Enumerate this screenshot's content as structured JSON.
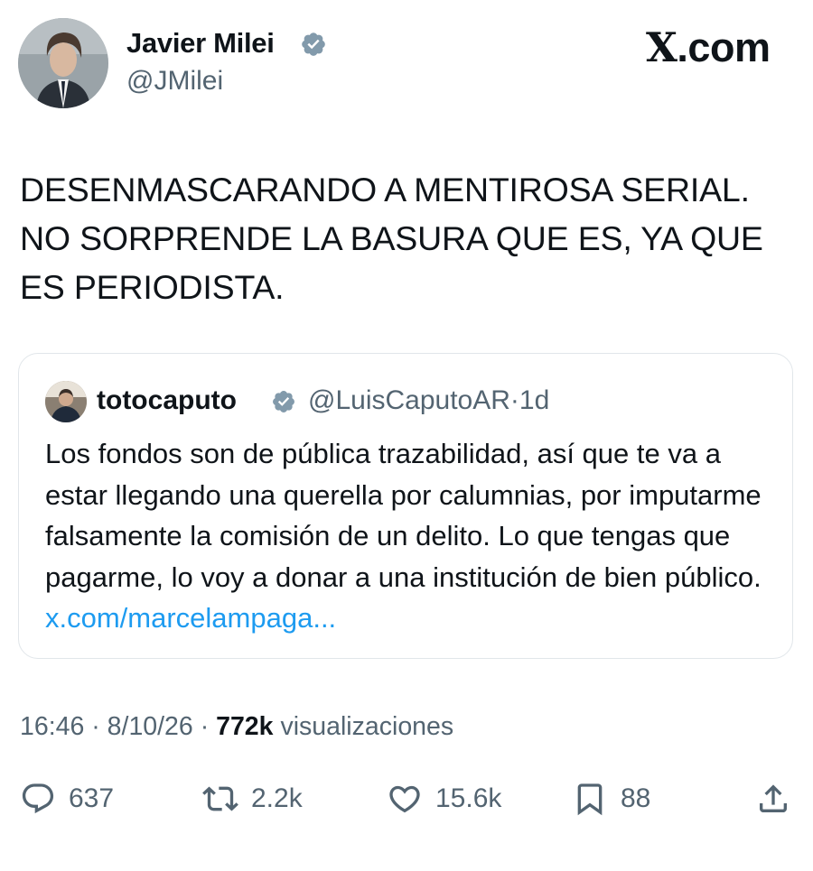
{
  "header": {
    "author_name": "Javier Milei",
    "author_handle": "@JMilei",
    "brand": "X.com",
    "brand_mark": "X",
    "brand_suffix": ".com"
  },
  "tweet": {
    "text": "DESENMASCARANDO A MENTIROSA SERIAL. NO SORPRENDE LA BASURA QUE ES, YA QUE ES PERIODISTA."
  },
  "quote": {
    "author_name": "totocaputo",
    "author_handle": "@LuisCaputoAR",
    "separator": "·",
    "age": "1d",
    "text": "Los fondos son de pública trazabilidad, así que te va a estar llegando una querella por calumnias, por imputarme falsamente la comisión de un delito. Lo que tengas que pagarme, lo voy a donar a una institución de bien público.",
    "link": "x.com/marcelampaga..."
  },
  "meta": {
    "time": "16:46",
    "date": "8/10/26",
    "separator": "·",
    "views_count": "772k",
    "views_label": "visualizaciones"
  },
  "actions": {
    "replies": "637",
    "reposts": "2.2k",
    "likes": "15.6k",
    "bookmarks": "88"
  },
  "icons": {
    "verified": "verified-badge-icon",
    "reply": "reply-icon",
    "repost": "repost-icon",
    "like": "heart-icon",
    "bookmark": "bookmark-icon",
    "share": "share-icon"
  },
  "colors": {
    "text": "#0f1419",
    "secondary": "#536471",
    "link": "#1d9bf0",
    "verified_badge": "#829aab"
  }
}
